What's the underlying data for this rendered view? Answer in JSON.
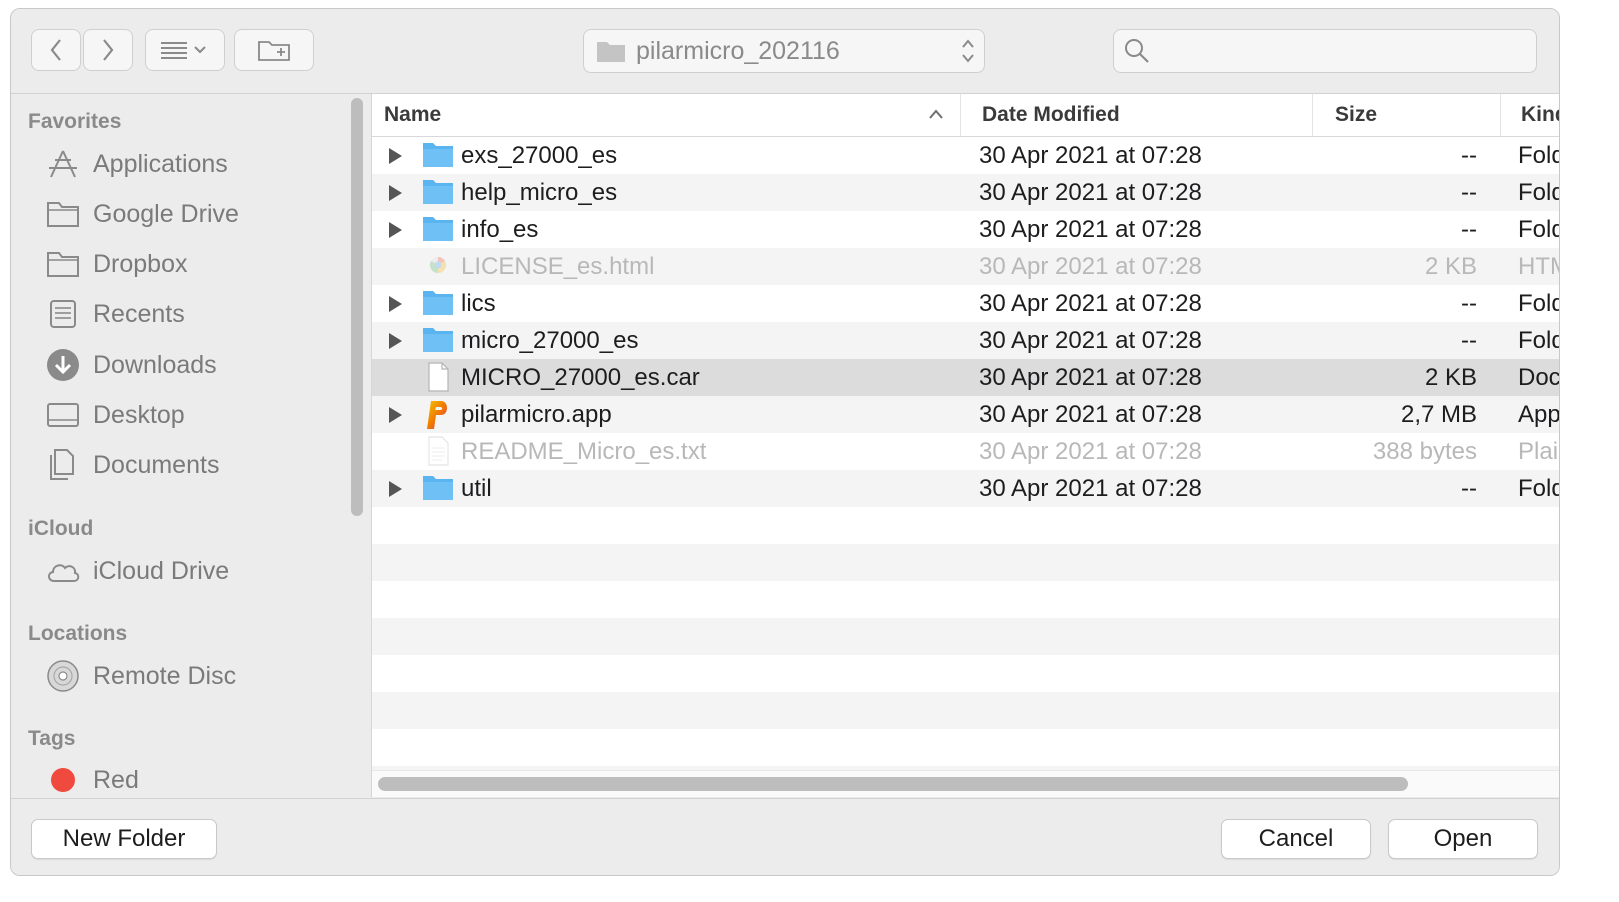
{
  "toolbar": {
    "back_icon": "chevron-left-icon",
    "forward_icon": "chevron-right-icon",
    "view_icon": "list-view-icon",
    "new_folder_icon": "folder-add-icon",
    "path_label": "pilarmicro_202116",
    "search_placeholder": ""
  },
  "sidebar": {
    "sections": [
      {
        "title": "Favorites",
        "items": [
          {
            "label": "Applications",
            "icon": "applications-icon"
          },
          {
            "label": "Google Drive",
            "icon": "folder-icon"
          },
          {
            "label": "Dropbox",
            "icon": "folder-icon"
          },
          {
            "label": "Recents",
            "icon": "recents-icon"
          },
          {
            "label": "Downloads",
            "icon": "downloads-icon"
          },
          {
            "label": "Desktop",
            "icon": "desktop-icon"
          },
          {
            "label": "Documents",
            "icon": "documents-icon"
          }
        ]
      },
      {
        "title": "iCloud",
        "items": [
          {
            "label": "iCloud Drive",
            "icon": "cloud-icon"
          }
        ]
      },
      {
        "title": "Locations",
        "items": [
          {
            "label": "Remote Disc",
            "icon": "disc-icon"
          }
        ]
      },
      {
        "title": "Tags",
        "items": [
          {
            "label": "Red",
            "icon": "red-tag-icon",
            "color": "#f0493e"
          }
        ]
      }
    ]
  },
  "columns": {
    "name": "Name",
    "date": "Date Modified",
    "size": "Size",
    "kind": "Kind"
  },
  "files": [
    {
      "name": "exs_27000_es",
      "date": "30 Apr 2021 at 07:28",
      "size": "--",
      "kind": "Folder",
      "type": "folder",
      "expandable": true
    },
    {
      "name": "help_micro_es",
      "date": "30 Apr 2021 at 07:28",
      "size": "--",
      "kind": "Folder",
      "type": "folder",
      "expandable": true
    },
    {
      "name": "info_es",
      "date": "30 Apr 2021 at 07:28",
      "size": "--",
      "kind": "Folder",
      "type": "folder",
      "expandable": true
    },
    {
      "name": "LICENSE_es.html",
      "date": "30 Apr 2021 at 07:28",
      "size": "2 KB",
      "kind": "HTML",
      "type": "html",
      "disabled": true
    },
    {
      "name": "lics",
      "date": "30 Apr 2021 at 07:28",
      "size": "--",
      "kind": "Folder",
      "type": "folder",
      "expandable": true
    },
    {
      "name": "micro_27000_es",
      "date": "30 Apr 2021 at 07:28",
      "size": "--",
      "kind": "Folder",
      "type": "folder",
      "expandable": true
    },
    {
      "name": "MICRO_27000_es.car",
      "date": "30 Apr 2021 at 07:28",
      "size": "2 KB",
      "kind": "Document",
      "type": "doc",
      "selected": true
    },
    {
      "name": "pilarmicro.app",
      "date": "30 Apr 2021 at 07:28",
      "size": "2,7 MB",
      "kind": "Application",
      "type": "app",
      "expandable": true
    },
    {
      "name": "README_Micro_es.txt",
      "date": "30 Apr 2021 at 07:28",
      "size": "388 bytes",
      "kind": "Plain Text",
      "type": "txt",
      "disabled": true
    },
    {
      "name": "util",
      "date": "30 Apr 2021 at 07:28",
      "size": "--",
      "kind": "Folder",
      "type": "folder",
      "expandable": true
    }
  ],
  "buttons": {
    "new_folder": "New Folder",
    "cancel": "Cancel",
    "open": "Open"
  },
  "colors": {
    "folder_blue": "#5ab4f0",
    "selection_gray": "#dcdcdc",
    "tag_red": "#f0493e"
  }
}
